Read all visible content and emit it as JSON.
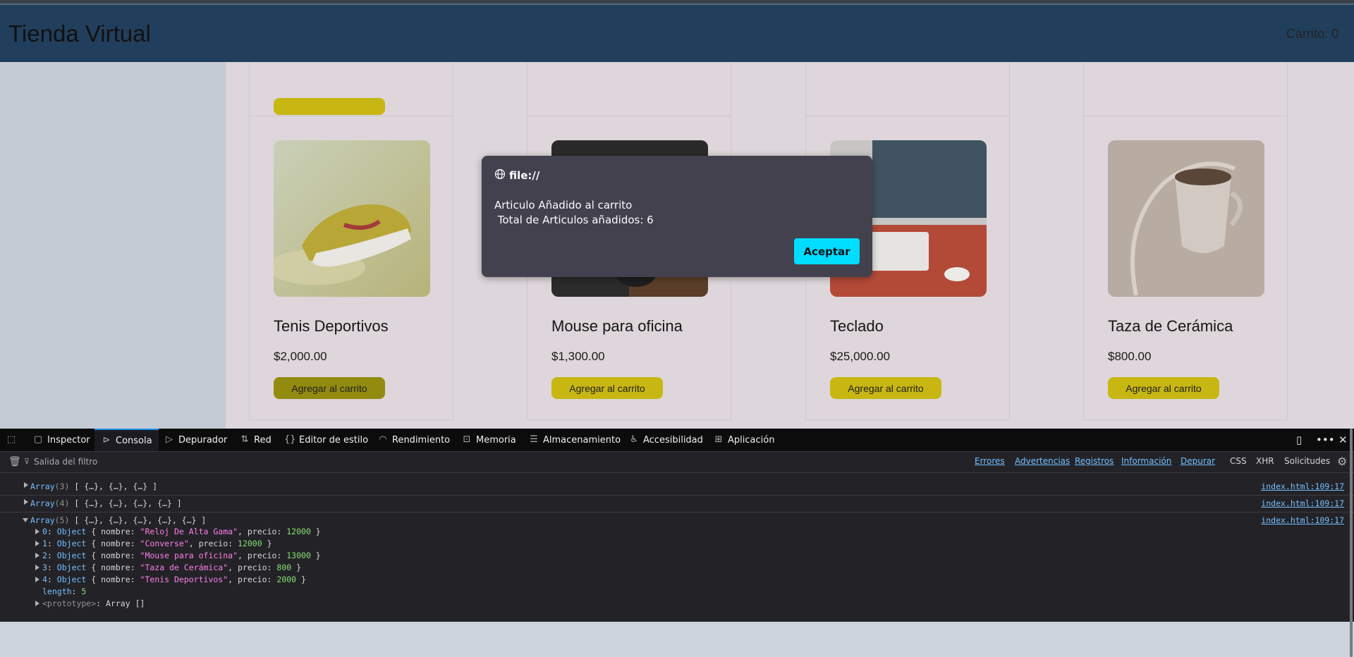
{
  "header": {
    "brand": "Tienda Virtual",
    "cart": "Carrito: 0"
  },
  "products": [
    {
      "name": "Tenis Deportivos",
      "price": "$2,000.00",
      "button": "Agregar al carrito"
    },
    {
      "name": "Mouse para oficina",
      "price": "$1,300.00",
      "button": "Agregar al carrito"
    },
    {
      "name": "Teclado",
      "price": "$25,000.00",
      "button": "Agregar al carrito"
    },
    {
      "name": "Taza de Cerámica",
      "price": "$800.00",
      "button": "Agregar al carrito"
    }
  ],
  "dialog": {
    "origin": "file://",
    "message": "Articulo Añadido al carrito\n Total de Articulos añadidos: 6",
    "ok": "Aceptar"
  },
  "devtools": {
    "tabs": [
      "Inspector",
      "Consola",
      "Depurador",
      "Red",
      "Editor de estilo",
      "Rendimiento",
      "Memoria",
      "Almacenamiento",
      "Accesibilidad",
      "Aplicación"
    ],
    "active_tab": "Consola",
    "filter_placeholder": "Salida del filtro",
    "filters": [
      "Errores",
      "Advertencias",
      "Registros",
      "Información",
      "Depurar"
    ],
    "toggles": [
      "CSS",
      "XHR",
      "Solicitudes"
    ],
    "console": {
      "rows": [
        {
          "label": "Array",
          "count": "(3)",
          "preview": "[ {…}, {…}, {…} ]",
          "location": "index.html:109:17"
        },
        {
          "label": "Array",
          "count": "(4)",
          "preview": "[ {…}, {…}, {…}, {…} ]",
          "location": "index.html:109:17"
        },
        {
          "label": "Array",
          "count": "(5)",
          "preview": "[ {…}, {…}, {…}, {…}, {…} ]",
          "location": "index.html:109:17"
        }
      ],
      "items": [
        {
          "idx": "0",
          "nombre": "\"Reloj De Alta Gama\"",
          "precio": "12000"
        },
        {
          "idx": "1",
          "nombre": "\"Converse\"",
          "precio": "12000"
        },
        {
          "idx": "2",
          "nombre": "\"Mouse para oficina\"",
          "precio": "13000"
        },
        {
          "idx": "3",
          "nombre": "\"Taza de Cerámica\"",
          "precio": "800"
        },
        {
          "idx": "4",
          "nombre": "\"Tenis Deportivos\"",
          "precio": "2000"
        }
      ],
      "length_label": "length",
      "length_value": "5",
      "prototype": "<prototype>",
      "prototype_value": "Array []"
    }
  }
}
